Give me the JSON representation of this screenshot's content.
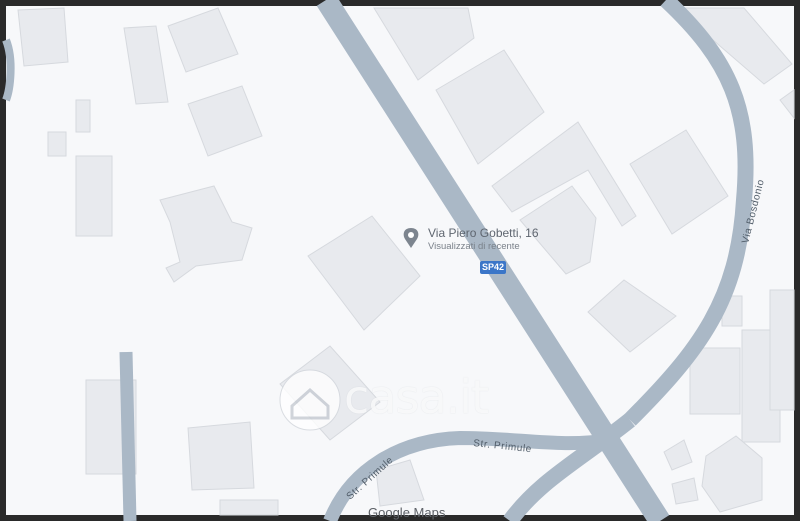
{
  "map": {
    "place": {
      "address": "Via Piero Gobetti, 16",
      "subtitle": "Visualizzati di recente",
      "marker_icon": "location-pin-icon"
    },
    "roads": [
      {
        "name": "Via Bosdonio"
      },
      {
        "name": "Str. Primule"
      },
      {
        "name": "Str. Primule"
      }
    ],
    "route_shield": "SP42",
    "attribution": "Google Maps",
    "watermark": {
      "text": "casa.it",
      "icon": "house-logo-icon"
    },
    "colors": {
      "land": "#f7f8fa",
      "building": "#e8eaee",
      "building_edge": "#d6d9de",
      "road": "#aab8c6",
      "shield": "#3b76c8"
    }
  }
}
